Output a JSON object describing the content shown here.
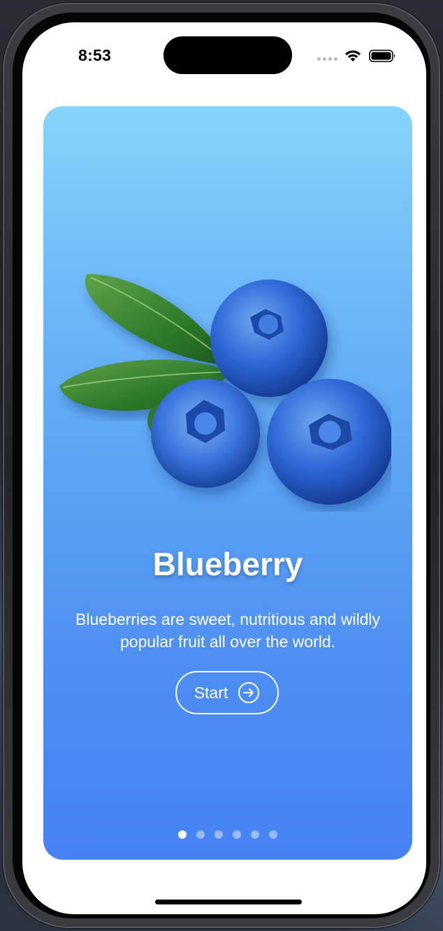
{
  "status_bar": {
    "time": "8:53",
    "icons": [
      "cellular-signal-icon",
      "wifi-icon",
      "battery-icon"
    ]
  },
  "onboarding": {
    "title": "Blueberry",
    "description": "Blueberries are sweet, nutritious and wildly popular fruit all over the world.",
    "start_label": "Start",
    "start_icon": "arrow-right-circle-icon",
    "image": "blueberries-with-leaves",
    "page_count": 6,
    "active_page": 1
  },
  "colors": {
    "card_gradient_top": "#86d4fb",
    "card_gradient_bottom": "#4682f4",
    "text": "#ffffff"
  }
}
